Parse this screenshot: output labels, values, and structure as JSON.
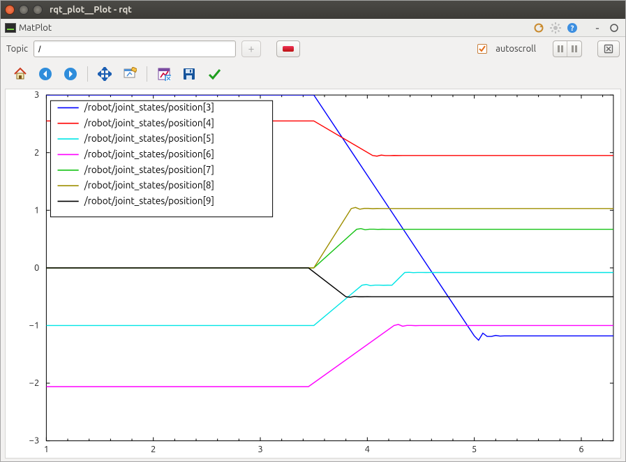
{
  "window": {
    "title": "rqt_plot__Plot - rqt"
  },
  "panel": {
    "title": "MatPlot"
  },
  "toolbar": {
    "topic_label": "Topic",
    "topic_value": "/",
    "add_tooltip": "add",
    "remove_tooltip": "remove",
    "autoscroll_label": "autoscroll",
    "autoscroll_checked": true
  },
  "mpl_toolbar": {
    "home": "home",
    "back": "back",
    "forward": "forward",
    "pan": "pan",
    "zoom": "zoom",
    "subplots": "configure-subplots",
    "save": "save-figure",
    "check": "edit"
  },
  "chart_data": {
    "type": "line",
    "xlabel": "",
    "ylabel": "",
    "xlim": [
      1,
      6.3
    ],
    "ylim": [
      -3,
      3
    ],
    "xticks": [
      1,
      2,
      3,
      4,
      5,
      6
    ],
    "yticks": [
      -3,
      -2,
      -1,
      0,
      1,
      2,
      3
    ],
    "legend_position": "upper-left",
    "series": [
      {
        "name": "/robot/joint_states/position[3]",
        "color": "#0000ff",
        "x": [
          1.0,
          3.5,
          5.0,
          6.3
        ],
        "y": [
          3.0,
          3.0,
          -1.18,
          -1.18
        ]
      },
      {
        "name": "/robot/joint_states/position[4]",
        "color": "#ff0000",
        "x": [
          1.0,
          3.5,
          4.05,
          6.3
        ],
        "y": [
          2.55,
          2.55,
          1.95,
          1.95
        ]
      },
      {
        "name": "/robot/joint_states/position[5]",
        "color": "#00e5e5",
        "x": [
          1.0,
          3.5,
          3.95,
          4.35,
          6.3
        ],
        "y": [
          -1.0,
          -1.0,
          -0.3,
          -0.08,
          -0.08
        ]
      },
      {
        "name": "/robot/joint_states/position[6]",
        "color": "#ff00ff",
        "x": [
          1.0,
          3.45,
          4.25,
          6.3
        ],
        "y": [
          -2.06,
          -2.06,
          -1.0,
          -1.0
        ]
      },
      {
        "name": "/robot/joint_states/position[7]",
        "color": "#14c214",
        "x": [
          1.0,
          3.5,
          3.9,
          6.3
        ],
        "y": [
          0.0,
          0.0,
          0.67,
          0.67
        ]
      },
      {
        "name": "/robot/joint_states/position[8]",
        "color": "#9e8f00",
        "x": [
          1.0,
          3.5,
          3.85,
          6.3
        ],
        "y": [
          0.0,
          0.0,
          1.03,
          1.03
        ]
      },
      {
        "name": "/robot/joint_states/position[9]",
        "color": "#000000",
        "x": [
          1.0,
          3.45,
          3.8,
          6.3
        ],
        "y": [
          0.0,
          0.0,
          -0.5,
          -0.5
        ]
      }
    ]
  }
}
